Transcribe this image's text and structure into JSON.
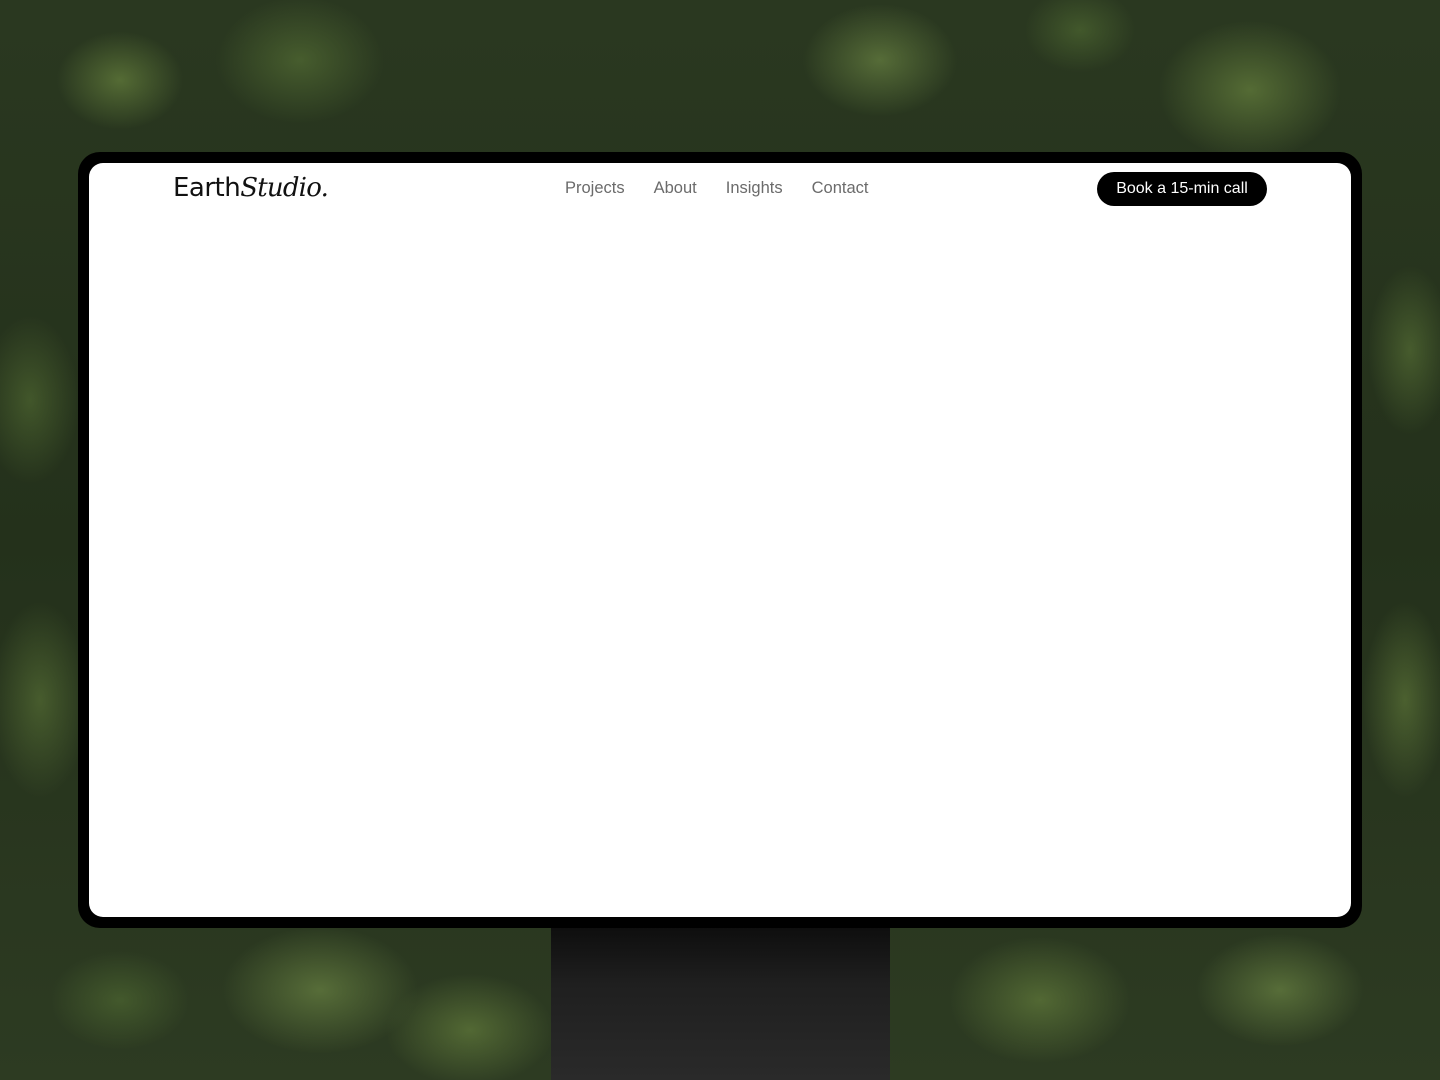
{
  "brand": {
    "logo_part1": "Earth",
    "logo_part2": "Studio."
  },
  "nav": {
    "links": [
      {
        "label": "Projects"
      },
      {
        "label": "About"
      },
      {
        "label": "Insights"
      },
      {
        "label": "Contact"
      }
    ],
    "cta_label": "Book a 15-min call"
  },
  "colors": {
    "background_forest": "#2a3820",
    "monitor_bezel": "#000000",
    "screen": "#ffffff",
    "nav_link": "#6b6b6b",
    "cta_bg": "#000000",
    "cta_text": "#ffffff"
  }
}
